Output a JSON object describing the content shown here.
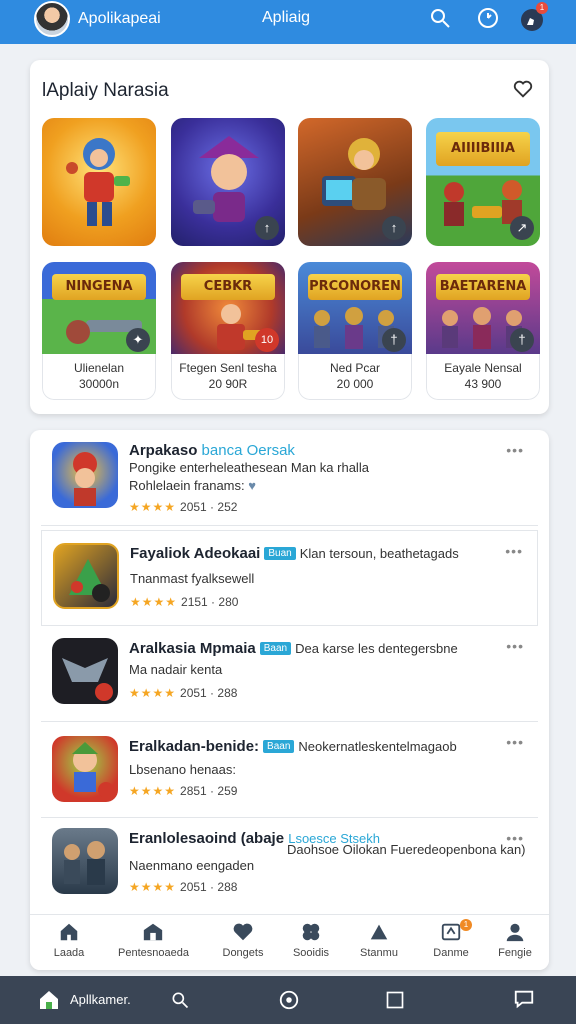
{
  "appbar": {
    "name": "Apolikapeai",
    "title": "Apliaig",
    "badge": "1",
    "icons": [
      "search-icon",
      "clock-icon",
      "profile-notification-icon"
    ]
  },
  "featured": {
    "title": "lAplaiy Narasia",
    "tiles": [
      {
        "banner": "",
        "tag": ""
      },
      {
        "banner": "",
        "tag": "↑"
      },
      {
        "banner": "",
        "tag": "↑"
      },
      {
        "banner": "AIIIIBIIIA",
        "tag": "↗"
      },
      {
        "banner": "NINGENA",
        "tag": "✦",
        "name": "Ulienelan",
        "sub": "30000n"
      },
      {
        "banner": "CEBKR",
        "tag": "10",
        "name": "Ftegen Senl tesha",
        "sub": "20 90R"
      },
      {
        "banner": "PRCONOREN",
        "tag": "†",
        "name": "Ned Pcar",
        "sub": "20 000"
      },
      {
        "banner": "BAETARENA",
        "tag": "†",
        "name": "Eayale Nensal",
        "sub": "43 900"
      }
    ]
  },
  "list": [
    {
      "title": "Arpakaso",
      "title_accent": "banca Oersak",
      "tag": "",
      "extra": "",
      "desc1": "Pongike enterheleathesean Man ka rhalla",
      "desc2": "Rohlelaein franams:",
      "stars": "★★★★",
      "meta": "2051 · 252",
      "more": "•••"
    },
    {
      "title": "Fayaliok Adeokaai",
      "title_accent": "",
      "tag": "Buan",
      "extra": "Klan tersoun, beathetagads",
      "desc1": "Tnanmast fyalksewell",
      "desc2": "",
      "stars": "★★★★",
      "meta": "2151 · 280",
      "more": "•••"
    },
    {
      "title": "Aralkasia Mpmaia",
      "title_accent": "",
      "tag": "Baan",
      "extra": "Dea karse les dentegersbne",
      "desc1": "Ma nadair kenta",
      "desc2": "",
      "stars": "★★★★",
      "meta": "2051 · 288",
      "more": "•••"
    },
    {
      "title": "Eralkadan-benide:",
      "title_accent": "",
      "tag": "Baan",
      "extra": "Neokernatleskentelmagaob",
      "desc1": "Lbsenano henaas:",
      "desc2": "",
      "stars": "★★★★",
      "meta": "2851 · 259",
      "more": "•••"
    },
    {
      "title": "Eranlolesaoind (abaje",
      "title_accent": "Lsoesce Stsekh",
      "tag": "",
      "extra": "Daohsoe Oilokan Fueredeopenbona kan)",
      "desc1": "Naenmano eengaden",
      "desc2": "",
      "stars": "★★★★",
      "meta": "2051 · 288",
      "more": "•••"
    }
  ],
  "tabs": [
    {
      "label": "Laada",
      "icon": "home-icon"
    },
    {
      "label": "Pentesnoaeda",
      "icon": "store-icon"
    },
    {
      "label": "Dongets",
      "icon": "heart-icon"
    },
    {
      "label": "Sooidis",
      "icon": "gamepad-icon"
    },
    {
      "label": "Stanmu",
      "icon": "shapes-icon"
    },
    {
      "label": "Danme",
      "icon": "download-icon",
      "badge": "1"
    },
    {
      "label": "Fengie",
      "icon": "profile-icon"
    }
  ],
  "sysnav": {
    "label": "Apllkamer.",
    "icons": [
      "home-icon",
      "search-icon",
      "circle-home-icon",
      "square-recents-icon",
      "chat-icon"
    ]
  }
}
